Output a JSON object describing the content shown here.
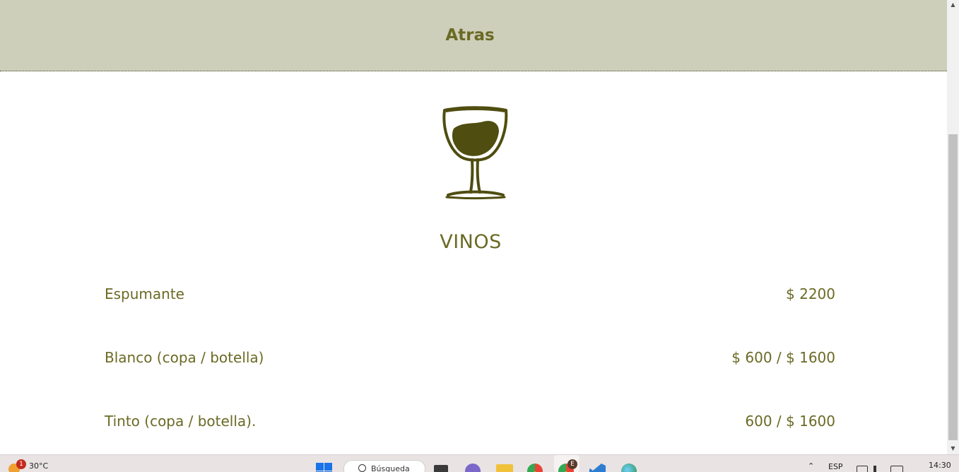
{
  "header": {
    "back_label": "Atras"
  },
  "section": {
    "icon": "wine-glass-icon",
    "title": "VINOS"
  },
  "menu": {
    "items": [
      {
        "name": "Espumante",
        "price": "$ 2200"
      },
      {
        "name": "Blanco (copa / botella)",
        "price": "$ 600 / $ 1600"
      },
      {
        "name": "Tinto (copa / botella).",
        "price": "600 / $ 1600"
      }
    ]
  },
  "taskbar": {
    "weather_temp": "30°C",
    "weather_badge": "1",
    "search_placeholder": "Búsqueda",
    "app_badge": "E",
    "language": "ESP",
    "time": "14:30"
  },
  "colors": {
    "header_bg": "#cdcfba",
    "accent_text": "#6b6a25",
    "glass_ink": "#4f4d10"
  }
}
